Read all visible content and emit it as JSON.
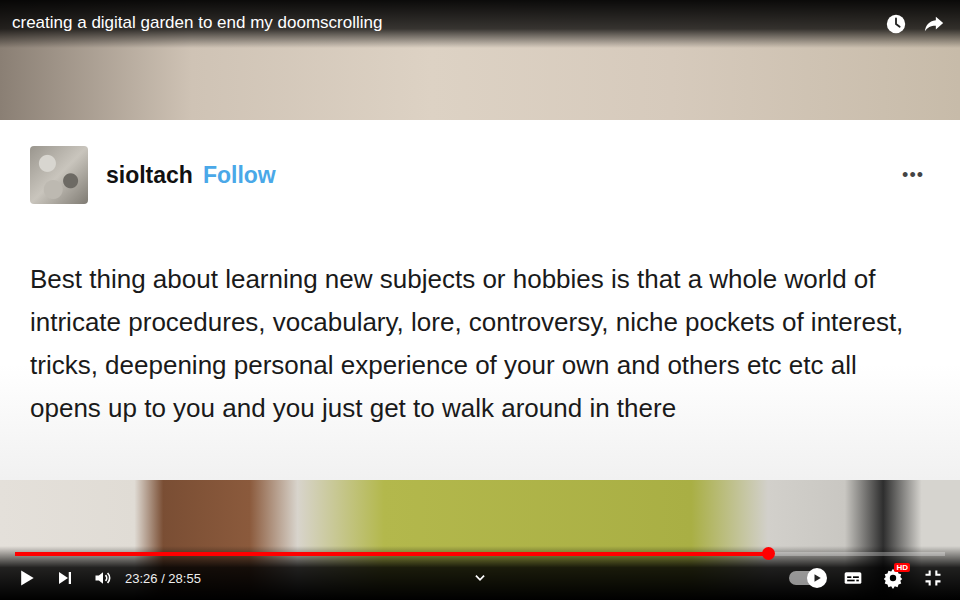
{
  "video": {
    "title": "creating a digital garden to end my doomscrolling"
  },
  "post": {
    "username": "sioltach",
    "follow": "Follow",
    "menu": "•••",
    "text": "Best thing about learning new subjects or hobbies is that a whole world of intricate procedures, vocabulary, lore, controversy, niche pockets of interest, tricks, deepening personal experience of your own and others etc etc all opens up to you and you just get to walk around in there"
  },
  "player": {
    "playing": false,
    "progress": {
      "level": 0.81
    },
    "time": "23:26 / 28:55",
    "autoplay": {
      "on": true
    },
    "settings_badge": "HD"
  }
}
